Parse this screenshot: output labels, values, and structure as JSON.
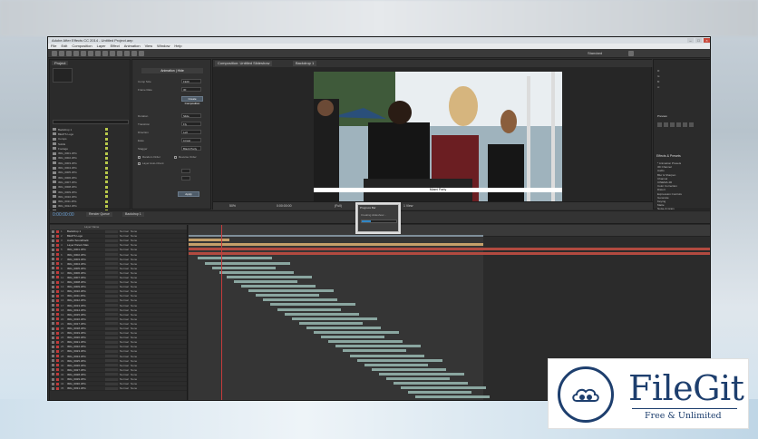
{
  "window": {
    "title": "Adobe After Effects CC 2014 - Untitled Project.aep",
    "controls": [
      "–",
      "□",
      "×"
    ]
  },
  "menu": [
    "File",
    "Edit",
    "Composition",
    "Layer",
    "Effect",
    "Animation",
    "View",
    "Window",
    "Help"
  ],
  "toolbar": {
    "workspace": "Standard"
  },
  "project": {
    "tab": "Project",
    "items": [
      "Backdrop 1",
      "BEATS Logo",
      "Comps",
      "Solids",
      "Footage",
      "IMG_0001.JPG",
      "IMG_0002.JPG",
      "IMG_0003.JPG",
      "IMG_0004.JPG",
      "IMG_0005.JPG",
      "IMG_0006.JPG",
      "IMG_0007.JPG",
      "IMG_0008.JPG",
      "IMG_0009.JPG",
      "IMG_0010.JPG",
      "IMG_0011.JPG",
      "IMG_0012.JPG",
      "IMG_0013.JPG",
      "IMG_0014.JPG",
      "IMG_0015.JPG",
      "IMG_0016.JPG",
      "IMG_0017.JPG",
      "IMG_0018.JPG"
    ]
  },
  "effect_panel": {
    "title": "Animation | Hide",
    "fields": [
      {
        "label": "Comp Size",
        "value": "1920"
      },
      {
        "label": "Frame Rate",
        "value": "30"
      }
    ],
    "button1": "Create Composition",
    "fields2": [
      {
        "label": "Duration",
        "value": "Slide"
      },
      {
        "label": "Transition",
        "value": "Fly"
      },
      {
        "label": "Direction",
        "value": "Left"
      },
      {
        "label": "Ease",
        "value": "Linear"
      },
      {
        "label": "Stagger",
        "value": "Black Party"
      }
    ],
    "checks": [
      "Random Order",
      "Reverse Order",
      "Layer Auto-Orient"
    ],
    "button2": "Apply"
  },
  "composition": {
    "tabs": [
      "Composition: Untitled Slideshow",
      "Backdrop 1"
    ],
    "caption": "Miami Party",
    "zoom": "50%",
    "time": "0:00:00:00",
    "resolution": "(Full)",
    "camera": "Active Camera",
    "views": "1 View"
  },
  "right_panel": {
    "info_lines": [
      "R:",
      "G:",
      "B:",
      "A:"
    ],
    "preview_tab": "Preview",
    "effects_tab": "Effects & Presets",
    "presets": [
      "* Animation Presets",
      "3D Channel",
      "Audio",
      "Blur & Sharpen",
      "Channel",
      "CINEMA 4D",
      "Color Correction",
      "Distort",
      "Expression Controls",
      "Generate",
      "Keying",
      "Matte",
      "Noise & Grain"
    ]
  },
  "timeline": {
    "timecode": "0:00:00:00",
    "tabs": [
      "Render Queue",
      "Backdrop 1"
    ],
    "column_header": "Layer Name",
    "layers": [
      {
        "num": "1",
        "name": "Backdrop 1",
        "mode": "Normal",
        "parent": "None"
      },
      {
        "num": "2",
        "name": "BEATS Logo",
        "mode": "Normal",
        "parent": "None"
      },
      {
        "num": "3",
        "name": "Audio Soundtrack",
        "mode": "Normal",
        "parent": "None"
      },
      {
        "num": "4",
        "name": "Layer Parent Mas",
        "mode": "Normal",
        "parent": "None"
      },
      {
        "num": "5",
        "name": "IMG_0001.JPG",
        "mode": "Normal",
        "parent": "None"
      },
      {
        "num": "6",
        "name": "IMG_0002.JPG",
        "mode": "Normal",
        "parent": "None"
      },
      {
        "num": "7",
        "name": "IMG_0003.JPG",
        "mode": "Normal",
        "parent": "None"
      },
      {
        "num": "8",
        "name": "IMG_0004.JPG",
        "mode": "Normal",
        "parent": "None"
      },
      {
        "num": "9",
        "name": "IMG_0005.JPG",
        "mode": "Normal",
        "parent": "None"
      },
      {
        "num": "10",
        "name": "IMG_0006.JPG",
        "mode": "Normal",
        "parent": "None"
      },
      {
        "num": "11",
        "name": "IMG_0007.JPG",
        "mode": "Normal",
        "parent": "None"
      },
      {
        "num": "12",
        "name": "IMG_0008.JPG",
        "mode": "Normal",
        "parent": "None"
      },
      {
        "num": "13",
        "name": "IMG_0009.JPG",
        "mode": "Normal",
        "parent": "None"
      },
      {
        "num": "14",
        "name": "IMG_0010.JPG",
        "mode": "Normal",
        "parent": "None"
      },
      {
        "num": "15",
        "name": "IMG_0011.JPG",
        "mode": "Normal",
        "parent": "None"
      },
      {
        "num": "16",
        "name": "IMG_0012.JPG",
        "mode": "Normal",
        "parent": "None"
      },
      {
        "num": "17",
        "name": "IMG_0013.JPG",
        "mode": "Normal",
        "parent": "None"
      },
      {
        "num": "18",
        "name": "IMG_0014.JPG",
        "mode": "Normal",
        "parent": "None"
      },
      {
        "num": "19",
        "name": "IMG_0015.JPG",
        "mode": "Normal",
        "parent": "None"
      },
      {
        "num": "20",
        "name": "IMG_0016.JPG",
        "mode": "Normal",
        "parent": "None"
      },
      {
        "num": "21",
        "name": "IMG_0017.JPG",
        "mode": "Normal",
        "parent": "None"
      },
      {
        "num": "22",
        "name": "IMG_0018.JPG",
        "mode": "Normal",
        "parent": "None"
      },
      {
        "num": "23",
        "name": "IMG_0019.JPG",
        "mode": "Normal",
        "parent": "None"
      },
      {
        "num": "24",
        "name": "IMG_0020.JPG",
        "mode": "Normal",
        "parent": "None"
      },
      {
        "num": "25",
        "name": "IMG_0021.JPG",
        "mode": "Normal",
        "parent": "None"
      },
      {
        "num": "26",
        "name": "IMG_0022.JPG",
        "mode": "Normal",
        "parent": "None"
      },
      {
        "num": "27",
        "name": "IMG_0023.JPG",
        "mode": "Normal",
        "parent": "None"
      },
      {
        "num": "28",
        "name": "IMG_0024.JPG",
        "mode": "Normal",
        "parent": "None"
      },
      {
        "num": "29",
        "name": "IMG_0025.JPG",
        "mode": "Normal",
        "parent": "None"
      },
      {
        "num": "30",
        "name": "IMG_0026.JPG",
        "mode": "Normal",
        "parent": "None"
      },
      {
        "num": "31",
        "name": "IMG_0027.JPG",
        "mode": "Normal",
        "parent": "None"
      },
      {
        "num": "32",
        "name": "IMG_0028.JPG",
        "mode": "Normal",
        "parent": "None"
      },
      {
        "num": "33",
        "name": "IMG_0029.JPG",
        "mode": "Normal",
        "parent": "None"
      },
      {
        "num": "34",
        "name": "IMG_0030.JPG",
        "mode": "Normal",
        "parent": "None"
      },
      {
        "num": "35",
        "name": "IMG_0031.JPG",
        "mode": "Normal",
        "parent": "None"
      }
    ],
    "footer": "Toggle Switches / Modes"
  },
  "progress_dialog": {
    "title": "Progress Bar",
    "text": "Creating slideshow...",
    "progress": 0.25
  },
  "watermark": {
    "name": "FileGit",
    "tagline": "Free & Unlimited",
    "color": "#1e3f6e"
  }
}
